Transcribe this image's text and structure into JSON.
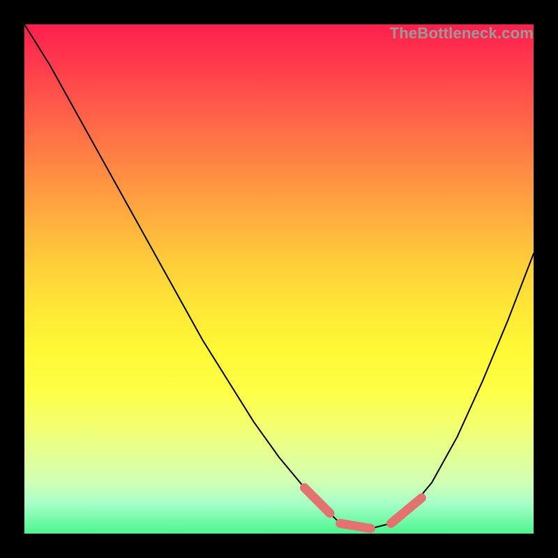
{
  "watermark": "TheBottleneck.com",
  "chart_data": {
    "type": "line",
    "title": "",
    "xlabel": "",
    "ylabel": "",
    "xlim": [
      0,
      100
    ],
    "ylim": [
      0,
      100
    ],
    "x": [
      0,
      5,
      10,
      15,
      20,
      25,
      30,
      35,
      40,
      45,
      50,
      55,
      60,
      62,
      65,
      68,
      72,
      75,
      80,
      85,
      90,
      95,
      100
    ],
    "values": [
      100,
      92,
      83,
      74,
      65,
      56,
      47,
      38,
      30,
      22,
      15,
      9,
      4,
      2,
      1,
      1,
      2,
      4,
      10,
      19,
      30,
      42,
      55
    ],
    "highlight_segments": [
      {
        "x0": 55,
        "y0": 9,
        "x1": 60,
        "y1": 4
      },
      {
        "x0": 62,
        "y0": 2,
        "x1": 68,
        "y1": 1
      },
      {
        "x0": 72,
        "y0": 2,
        "x1": 78,
        "y1": 7
      }
    ],
    "colors": {
      "curve": "#000000",
      "highlight": "#e2736f",
      "background_top": "#ff1f4d",
      "background_bottom": "#4cf58e"
    }
  }
}
